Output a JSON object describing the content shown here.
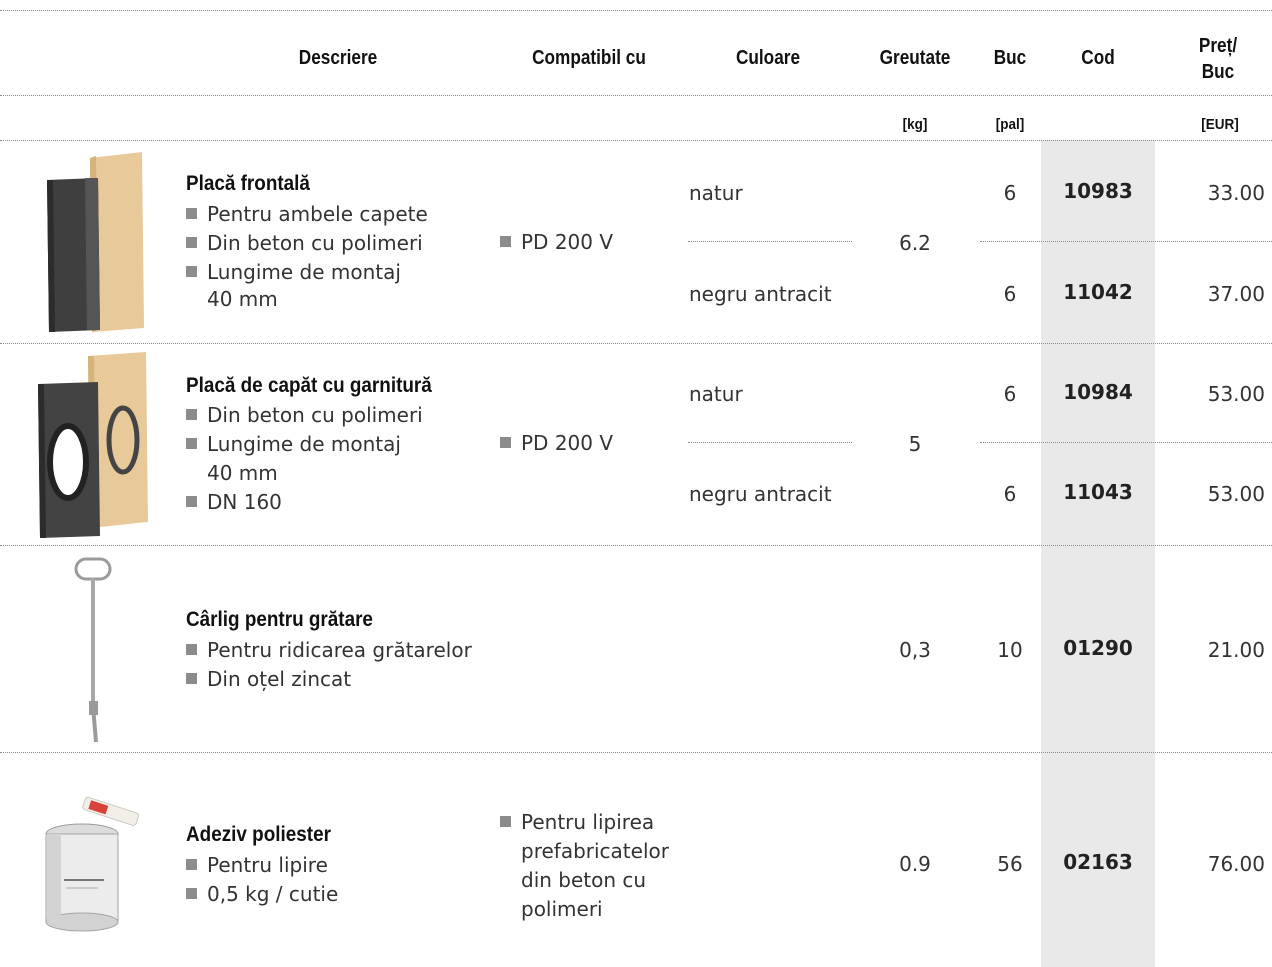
{
  "columns": {
    "description": "Descriere",
    "compatible": "Compatibil cu",
    "color": "Culoare",
    "weight": "Greutate",
    "pieces": "Buc",
    "code": "Cod",
    "price_line1": "Preț/",
    "price_line2": "Buc"
  },
  "units": {
    "weight": "[kg]",
    "pieces": "[pal]",
    "price": "[EUR]"
  },
  "products": [
    {
      "title": "Placă frontală",
      "bullets": [
        "Pentru ambele capete",
        "Din beton cu polimeri",
        "Lungime de montaj",
        "40   mm"
      ],
      "compatible": "PD 200   V",
      "weight": "6.2",
      "variants": [
        {
          "color": "natur",
          "pieces": "6",
          "code": "10983",
          "price": "33.00"
        },
        {
          "color": "negru antracit",
          "pieces": "6",
          "code": "11042",
          "price": "37.00"
        }
      ]
    },
    {
      "title": "Placă de capăt cu garnitură",
      "bullets": [
        "Din beton cu polimeri",
        "Lungime de montaj",
        "40   mm",
        "DN 160"
      ],
      "compatible": "PD 200 V",
      "weight": "5",
      "variants": [
        {
          "color": "natur",
          "pieces": "6",
          "code": "10984",
          "price": "53.00"
        },
        {
          "color": "negru antracit",
          "pieces": "6",
          "code": "11043",
          "price": "53.00"
        }
      ]
    },
    {
      "title": "Cârlig pentru grătare",
      "bullets": [
        "Pentru ridicarea grătarelor",
        "Din oțel zincat"
      ],
      "weight": "0,3",
      "pieces": "10",
      "code": "01290",
      "price": "21.00"
    },
    {
      "title": "Adeziv poliester",
      "bullets": [
        "Pentru lipire",
        "0,5   kg / cutie"
      ],
      "compatible_lines": [
        "Pentru lipirea",
        "prefabricatelor",
        "din beton cu",
        "polimeri"
      ],
      "weight": "0.9",
      "pieces": "56",
      "code": "02163",
      "price": "76.00"
    }
  ],
  "colors": {
    "code_column_bg": "#e9e9e9",
    "bullet": "#8c8c8c",
    "line": "#8a8a8a"
  }
}
